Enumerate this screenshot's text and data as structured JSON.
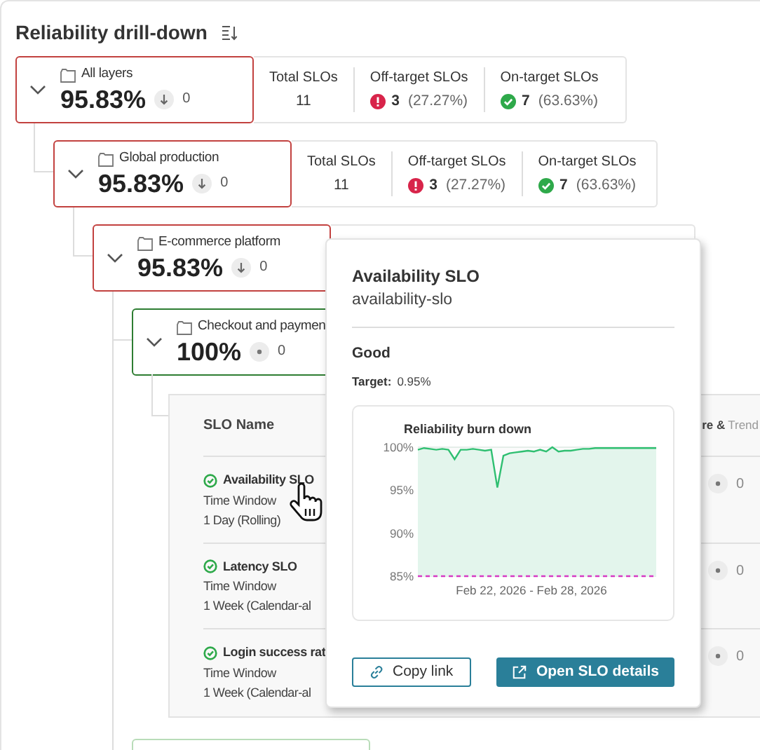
{
  "header": {
    "title": "Reliability drill-down"
  },
  "nodes": [
    {
      "label": "All layers",
      "value": "95.83%",
      "trend": {
        "kind": "down",
        "value": "0"
      },
      "color": "#c2413f",
      "expanded": true,
      "stats": [
        {
          "kind": "total",
          "label": "Total SLOs",
          "value": "11"
        },
        {
          "kind": "off",
          "label": "Off-target SLOs",
          "value": "3",
          "share": "(27.27%)"
        },
        {
          "kind": "on",
          "label": "On-target SLOs",
          "value": "7",
          "share": "(63.63%)"
        }
      ]
    },
    {
      "label": "Global production",
      "value": "95.83%",
      "trend": {
        "kind": "down",
        "value": "0"
      },
      "color": "#c2413f",
      "expanded": true,
      "stats": [
        {
          "kind": "total",
          "label": "Total SLOs",
          "value": "11"
        },
        {
          "kind": "off",
          "label": "Off-target SLOs",
          "value": "3",
          "share": "(27.27%)"
        },
        {
          "kind": "on",
          "label": "On-target SLOs",
          "value": "7",
          "share": "(63.63%)"
        }
      ]
    },
    {
      "label": "E-commerce platform",
      "value": "95.83%",
      "trend": {
        "kind": "down",
        "value": "0"
      },
      "color": "#c2413f",
      "expanded": true
    },
    {
      "label": "Checkout and paymen",
      "value": "100%",
      "trend": {
        "kind": "flat",
        "value": "0"
      },
      "color": "#2e7d32",
      "expanded": true
    }
  ],
  "table": {
    "columns": [
      "SLO Name"
    ],
    "column_end": {
      "head": "re &",
      "tail": "Trend"
    },
    "rows": [
      {
        "name": "Availability SLO",
        "window_label": "Time Window",
        "window": "1 Day (Rolling)",
        "trend": "0"
      },
      {
        "name": "Latency SLO",
        "window_label": "Time Window",
        "window": "1 Week (Calendar-al",
        "trend": "0"
      },
      {
        "name": "Login success rat",
        "window_label": "Time Window",
        "window": "1 Week (Calendar-al",
        "trend": "0"
      }
    ]
  },
  "next_node": {
    "color": "#b9dcb9"
  },
  "popover": {
    "title": "Availability SLO",
    "subtitle": "availability-slo",
    "state": "Good",
    "target_label": "Target:",
    "target": "0.95%",
    "chart_data": {
      "type": "line",
      "title": "Reliability burn down",
      "xlabel": "Feb 22, 2026 - Feb 28, 2026",
      "ylim": [
        85,
        100
      ],
      "yticks": [
        {
          "value": 85,
          "label": "85%"
        },
        {
          "value": 90,
          "label": "90%"
        },
        {
          "value": 95,
          "label": "95%"
        },
        {
          "value": 100,
          "label": "100%"
        }
      ],
      "series": [
        {
          "color": "#2fbf71",
          "values": [
            99.7,
            99.9,
            99.8,
            99.7,
            99.8,
            99.7,
            98.6,
            99.7,
            99.7,
            99.8,
            99.7,
            99.6,
            99.7,
            95.3,
            99.0,
            99.3,
            99.4,
            99.5,
            99.6,
            99.5,
            99.7,
            99.5,
            100,
            99.5,
            99.6,
            99.6,
            99.7,
            99.8,
            99.8,
            99.9,
            99.9,
            99.9,
            99.9,
            99.9,
            99.9,
            99.9,
            99.9,
            99.9,
            99.9,
            99.9
          ]
        },
        {
          "color": "#d63bc4",
          "line_style": "dashed",
          "values": [
            85,
            85,
            85,
            85,
            85,
            85,
            85,
            85,
            85,
            85,
            85,
            85,
            85,
            85,
            85,
            85,
            85,
            85,
            85,
            85,
            85,
            85,
            85,
            85,
            85,
            85,
            85,
            85,
            85,
            85,
            85,
            85,
            85,
            85,
            85,
            85,
            85,
            85,
            85,
            85
          ]
        }
      ]
    },
    "buttons": [
      {
        "kind": "secondary",
        "label": "Copy link"
      },
      {
        "kind": "primary",
        "label": "Open SLO details"
      }
    ]
  }
}
